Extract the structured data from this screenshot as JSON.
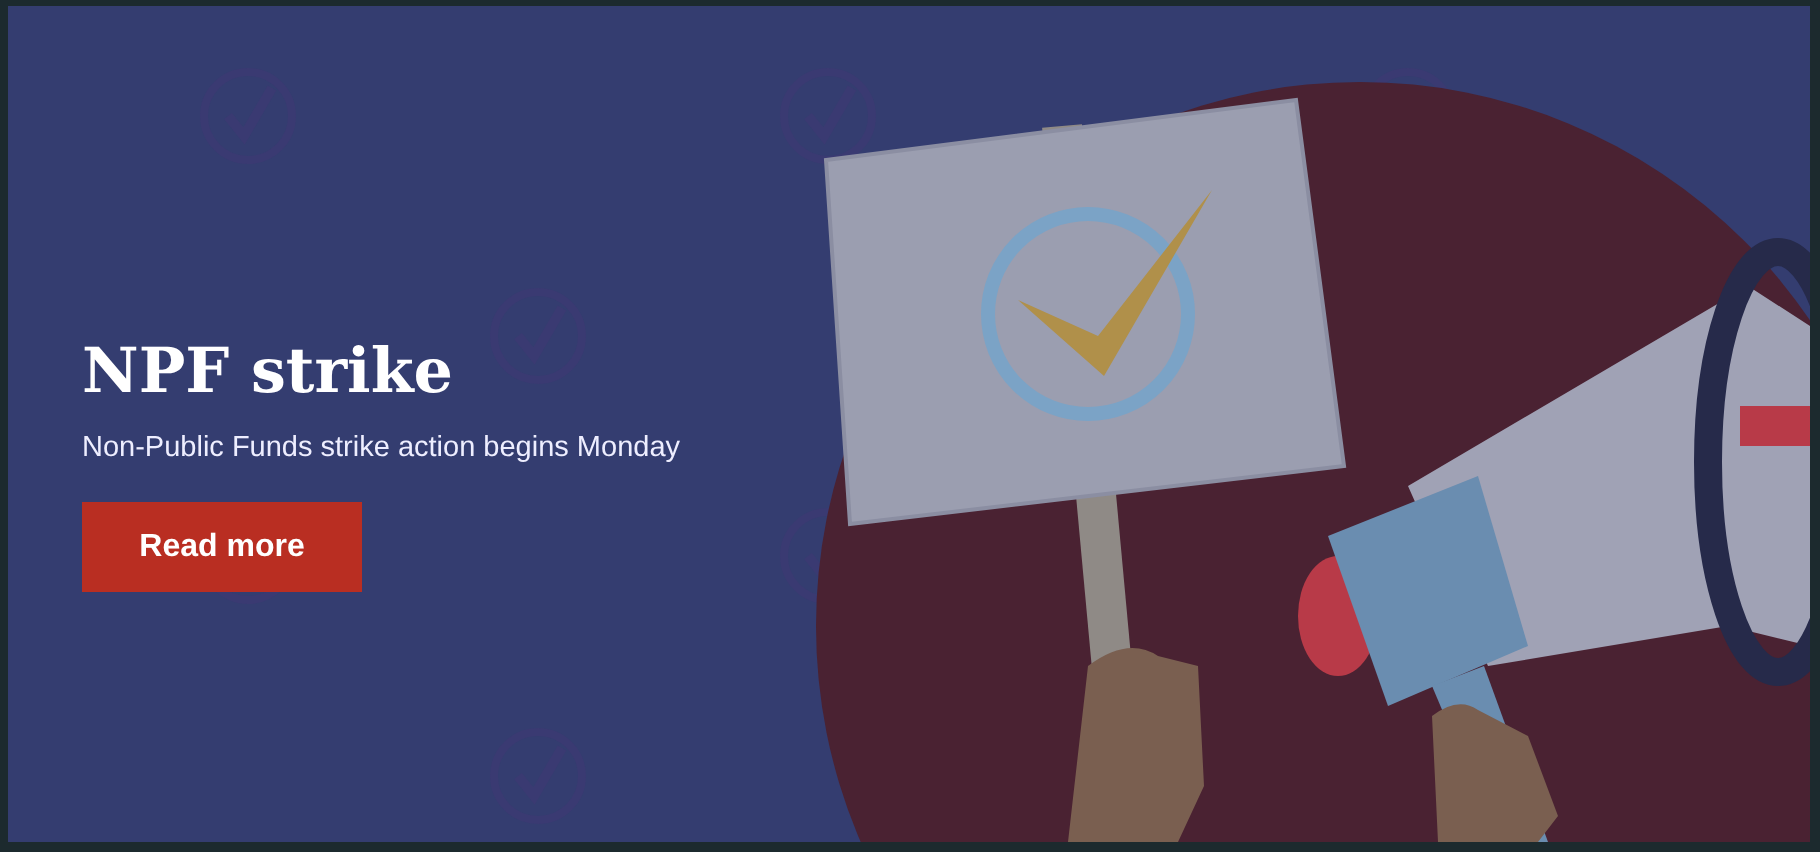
{
  "banner": {
    "title": "NPF strike",
    "subtitle": "Non-Public Funds strike action begins Monday",
    "button": "Read more"
  }
}
